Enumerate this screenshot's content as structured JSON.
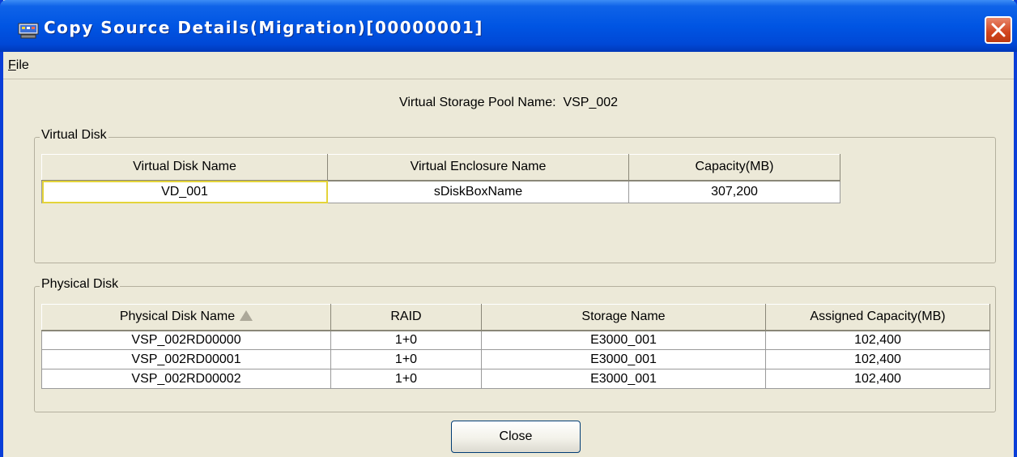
{
  "window": {
    "title": "Copy Source Details(Migration)[00000001]",
    "close_label": "×"
  },
  "menu": {
    "file_mnemonic": "F",
    "file_rest": "ile"
  },
  "pool": {
    "label": "Virtual Storage Pool Name:",
    "value": "VSP_002"
  },
  "virtual_disk": {
    "legend": "Virtual Disk",
    "columns": [
      "Virtual Disk Name",
      "Virtual Enclosure Name",
      "Capacity(MB)"
    ],
    "rows": [
      [
        "VD_001",
        "sDiskBoxName",
        "307,200"
      ]
    ]
  },
  "physical_disk": {
    "legend": "Physical Disk",
    "columns": [
      "Physical Disk Name",
      "RAID",
      "Storage Name",
      "Assigned Capacity(MB)"
    ],
    "rows": [
      [
        "VSP_002RD00000",
        "1+0",
        "E3000_001",
        "102,400"
      ],
      [
        "VSP_002RD00001",
        "1+0",
        "E3000_001",
        "102,400"
      ],
      [
        "VSP_002RD00002",
        "1+0",
        "E3000_001",
        "102,400"
      ]
    ]
  },
  "buttons": {
    "close": "Close"
  },
  "colors": {
    "titlebar": "#0055e3",
    "window_bg": "#ece9d8",
    "close_red": "#d2451e",
    "selection_outline": "#e4d43a"
  },
  "icons": [
    "app-icon",
    "close-icon",
    "sort-ascending-icon"
  ]
}
